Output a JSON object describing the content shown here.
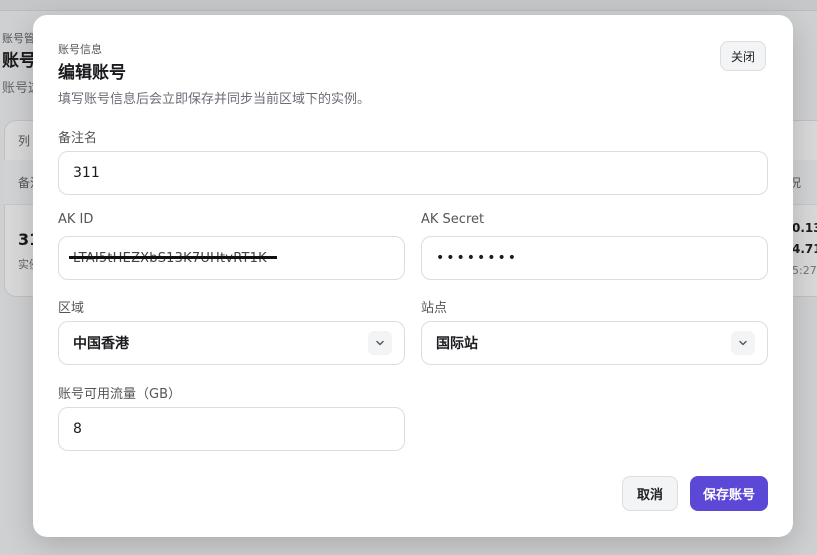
{
  "background": {
    "breadcrumb": "账号管",
    "title": "账号",
    "subtitle": "账号这",
    "list_header": "列",
    "table_col_first": "备注",
    "table_col_last": "况",
    "row_name": "31",
    "row_sub": "实例",
    "row_val1": "0.13",
    "row_val2": "4.71",
    "row_val3": "5:27"
  },
  "modal": {
    "eyebrow": "账号信息",
    "title": "编辑账号",
    "description": "填写账号信息后会立即保存并同步当前区域下的实例。",
    "close_label": "关闭",
    "fields": {
      "remark": {
        "label": "备注名",
        "value": "311"
      },
      "ak_id": {
        "label": "AK ID",
        "value": "LTAI5tHEZXbS13K7UHtvRT1K"
      },
      "ak_secret": {
        "label": "AK Secret",
        "value": "••••••••"
      },
      "region": {
        "label": "区域",
        "value": "中国香港"
      },
      "site": {
        "label": "站点",
        "value": "国际站"
      },
      "traffic": {
        "label": "账号可用流量（GB）",
        "value": "8"
      }
    },
    "cancel_label": "取消",
    "save_label": "保存账号"
  },
  "colors": {
    "accent": "#5b48d6",
    "border": "#dcdde2"
  },
  "icons": {
    "region_chevron": "chevron-down-icon",
    "site_chevron": "chevron-down-icon"
  }
}
